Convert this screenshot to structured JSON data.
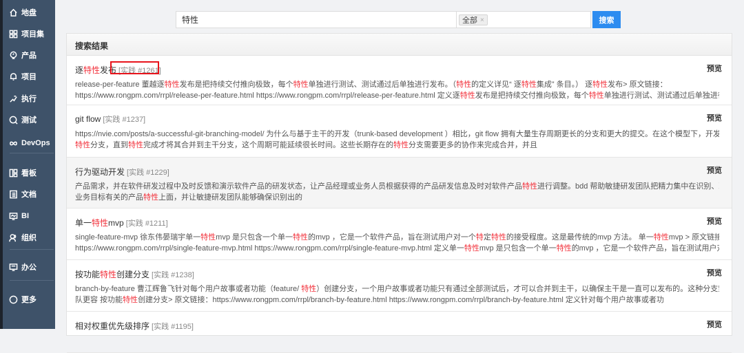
{
  "sidebar": {
    "items": [
      {
        "label": "地盘",
        "icon": "home-icon"
      },
      {
        "label": "项目集",
        "icon": "grid-icon"
      },
      {
        "label": "产品",
        "icon": "bulb-icon"
      },
      {
        "label": "项目",
        "icon": "bell-icon"
      },
      {
        "label": "执行",
        "icon": "run-icon"
      },
      {
        "label": "测试",
        "icon": "search-icon"
      },
      {
        "label": "DevOps",
        "icon": "infinity-icon"
      },
      {
        "label": "看板",
        "icon": "kanban-icon"
      },
      {
        "label": "文档",
        "icon": "doc-icon"
      },
      {
        "label": "BI",
        "icon": "monitor-icon"
      },
      {
        "label": "组织",
        "icon": "users-icon"
      },
      {
        "label": "办公",
        "icon": "office-icon"
      },
      {
        "label": "更多",
        "icon": "more-icon"
      }
    ]
  },
  "search": {
    "query": "特性",
    "scope": "全部",
    "scope_remove": "×",
    "button": "搜索"
  },
  "results_header": "搜索结果",
  "preview_label": "预览",
  "results": [
    {
      "title": [
        {
          "t": "逐"
        },
        {
          "t": "特性",
          "h": 1
        },
        {
          "t": "发布"
        }
      ],
      "tag": "[实践 #1261]",
      "lines": [
        [
          {
            "t": "release-per-feature 董越逐"
          },
          {
            "t": "特性",
            "h": 1
          },
          {
            "t": "发布是把持续交付推向极致，每个"
          },
          {
            "t": "特性",
            "h": 1
          },
          {
            "t": "单独进行测试、测试通过后单独进行发布。（"
          },
          {
            "t": "特性",
            "h": 1
          },
          {
            "t": "的定义详见“ 逐"
          },
          {
            "t": "特性",
            "h": 1
          },
          {
            "t": "集成” 条目。） 逐"
          },
          {
            "t": "特性",
            "h": 1
          },
          {
            "t": "发布> 原文链接："
          }
        ],
        [
          {
            "t": "https://www.rongpm.com/rrpl/release-per-feature.html https://www.rongpm.com/rrpl/release-per-feature.html 定义逐"
          },
          {
            "t": "特性",
            "h": 1
          },
          {
            "t": "发布是把持续交付推向极致，每个"
          },
          {
            "t": "特性",
            "h": 1
          },
          {
            "t": "单独进行测试、测试通过后单独进行发布"
          }
        ]
      ]
    },
    {
      "title": [
        {
          "t": "git flow"
        }
      ],
      "tag": "[实践 #1237]",
      "lines": [
        [
          {
            "t": "https://nvie.com/posts/a-successful-git-branching-model/ 为什么与基于主干的开发（trunk-based development ）相比，git flow 拥有大量生存周期更长的分支和更大的提交。在这个模型下，开发人员创建一个"
          }
        ],
        [
          {
            "t": "特性",
            "h": 1
          },
          {
            "t": "分支，直到"
          },
          {
            "t": "特性",
            "h": 1
          },
          {
            "t": "完成才将其合并到主干分支，这个周期可能延续很长时间。这些长期存在的"
          },
          {
            "t": "特性",
            "h": 1
          },
          {
            "t": "分支需要更多的协作来完成合并，并且"
          }
        ]
      ]
    },
    {
      "title": [
        {
          "t": "行为驱动开发"
        }
      ],
      "tag": "[实践 #1229]",
      "lines": [
        [
          {
            "t": "产品需求，并在软件研发过程中及时反馈和演示软件产品的研发状态，让产品经理或业务人员根据获得的产品研发信息及时对软件产品"
          },
          {
            "t": "特性",
            "h": 1
          },
          {
            "t": "进行调整。bdd 帮助敏捷研发团队把精力集中在识别、理解和构建跟"
          }
        ],
        [
          {
            "t": "业务目标有关的产品"
          },
          {
            "t": "特性",
            "h": 1
          },
          {
            "t": "上面，并让敏捷研发团队能够确保识别出的"
          }
        ]
      ]
    },
    {
      "title": [
        {
          "t": "单一"
        },
        {
          "t": "特性",
          "h": 1
        },
        {
          "t": "mvp"
        }
      ],
      "tag": "[实践 #1211]",
      "lines": [
        [
          {
            "t": "single-feature-mvp 徐东伟晏瑞宇单一"
          },
          {
            "t": "特性",
            "h": 1
          },
          {
            "t": "mvp 是只包含一个单一"
          },
          {
            "t": "特性",
            "h": 1
          },
          {
            "t": "的mvp ，它是一个软件产品，旨在测试用户对一个"
          },
          {
            "t": "特",
            "h": 1
          },
          {
            "t": "定"
          },
          {
            "t": "特性",
            "h": 1
          },
          {
            "t": "的接受程度。这是最传统的mvp 方法。 单一"
          },
          {
            "t": "特性",
            "h": 1
          },
          {
            "t": "mvp > 原文链接："
          }
        ],
        [
          {
            "t": "https://www.rongpm.com/rrpl/single-feature-mvp.html https://www.rongpm.com/rrpl/single-feature-mvp.html 定义单一"
          },
          {
            "t": "特性",
            "h": 1
          },
          {
            "t": "mvp 是只包含一个单一"
          },
          {
            "t": "特性",
            "h": 1
          },
          {
            "t": "的mvp ，它是一个软件产品，旨在测试用户对一"
          }
        ]
      ]
    },
    {
      "title": [
        {
          "t": "按功能"
        },
        {
          "t": "特性",
          "h": 1
        },
        {
          "t": "创建分支"
        }
      ],
      "tag": "[实践 #1238]",
      "lines": [
        [
          {
            "t": "branch-by-feature 曹江辉鲁飞针对每个用户故事或者功能（feature/ "
          },
          {
            "t": "特性",
            "h": 1
          },
          {
            "t": "）创建分支，一个用户故事或者功能只有通过全部测试后，才可以合并到主干，以确保主干是一直可以发布的。这种分支策略让开发团"
          }
        ],
        [
          {
            "t": "队更容 按功能"
          },
          {
            "t": "特性",
            "h": 1
          },
          {
            "t": "创建分支> 原文链接：https://www.rongpm.com/rrpl/branch-by-feature.html https://www.rongpm.com/rrpl/branch-by-feature.html 定义针对每个用户故事或者功"
          }
        ]
      ]
    },
    {
      "title": [
        {
          "t": "相对权重优先级排序"
        }
      ],
      "tag": "[实践 #1195]",
      "lines": []
    }
  ]
}
